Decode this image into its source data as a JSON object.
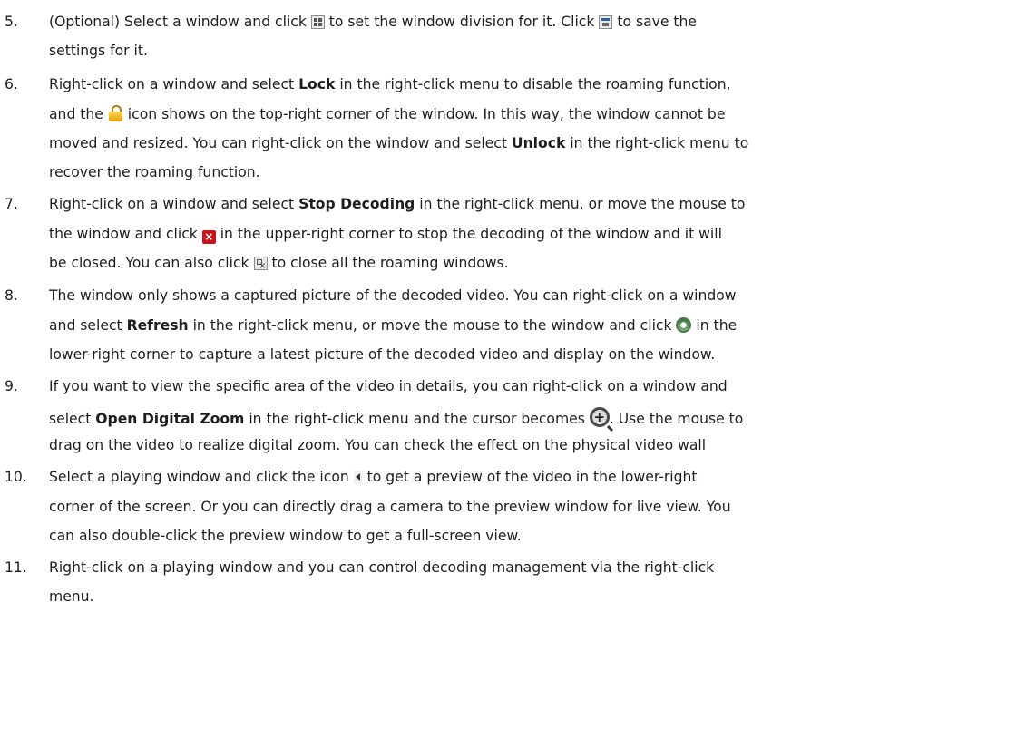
{
  "items": [
    {
      "number": "5.",
      "lines": [
        [
          {
            "t": "(Optional) Select a window and click "
          },
          {
            "icon": "window-division-icon"
          },
          {
            "t": " to set the window division for it. Click "
          },
          {
            "icon": "save-icon"
          },
          {
            "t": " to save the"
          }
        ],
        [
          {
            "t": "settings for it."
          }
        ]
      ]
    },
    {
      "number": "6.",
      "lines": [
        [
          {
            "t": "Right-click on a window and select "
          },
          {
            "b": "Lock"
          },
          {
            "t": " in the right-click menu to disable the roaming function,"
          }
        ],
        [
          {
            "t": "and the "
          },
          {
            "icon": "lock-icon"
          },
          {
            "t": " icon shows on the top-right corner of the window. In this way, the window cannot be"
          }
        ],
        [
          {
            "t": "moved and resized. You can right-click on the window and select "
          },
          {
            "b": "Unlock"
          },
          {
            "t": " in the right-click menu to"
          }
        ],
        [
          {
            "t": "recover the roaming function."
          }
        ]
      ]
    },
    {
      "number": "7.",
      "lines": [
        [
          {
            "t": "Right-click on a window and select "
          },
          {
            "b": "Stop Decoding"
          },
          {
            "t": " in the right-click menu, or move the mouse to"
          }
        ],
        [
          {
            "t": "the window and click "
          },
          {
            "icon": "stop-decoding-icon"
          },
          {
            "t": " in the upper-right corner to stop the decoding of the window and it will"
          }
        ],
        [
          {
            "t": "be closed. You can also click "
          },
          {
            "icon": "close-all-windows-icon"
          },
          {
            "t": " to close all the roaming windows."
          }
        ]
      ]
    },
    {
      "number": "8.",
      "lines": [
        [
          {
            "t": "The window only shows a captured picture of the decoded video. You can right-click on a window"
          }
        ],
        [
          {
            "t": "and select "
          },
          {
            "b": "Refresh"
          },
          {
            "t": " in the right-click menu, or move the mouse to the window and click "
          },
          {
            "icon": "refresh-icon"
          },
          {
            "t": " in the"
          }
        ],
        [
          {
            "t": "lower-right corner to capture a latest picture of the decoded video and display on the window."
          }
        ]
      ]
    },
    {
      "number": "9.",
      "lines": [
        [
          {
            "t": "If you want to view the specific area of the video in details, you can right-click on a window and"
          }
        ],
        [
          {
            "t": "select "
          },
          {
            "b": "Open Digital Zoom"
          },
          {
            "t": " in the right-click menu and the cursor becomes "
          },
          {
            "icon": "digital-zoom-cursor-icon"
          },
          {
            "t": ". Use the mouse to"
          }
        ],
        [
          {
            "t": "drag on the video to realize digital zoom. You can check the effect on the physical video wall"
          }
        ]
      ]
    },
    {
      "number": "10.",
      "lines": [
        [
          {
            "t": "Select a playing window and click the icon "
          },
          {
            "icon": "preview-arrow-icon"
          },
          {
            "t": " to get a preview of the video in the lower-right"
          }
        ],
        [
          {
            "t": "corner of the screen. Or you can directly drag a camera to the preview window for live view. You"
          }
        ],
        [
          {
            "t": "can also double-click the preview window to get a full-screen view."
          }
        ]
      ]
    },
    {
      "number": "11.",
      "lines": [
        [
          {
            "t": "Right-click on a playing window and you can control decoding management via the right-click"
          }
        ],
        [
          {
            "t": "menu."
          }
        ]
      ]
    }
  ]
}
